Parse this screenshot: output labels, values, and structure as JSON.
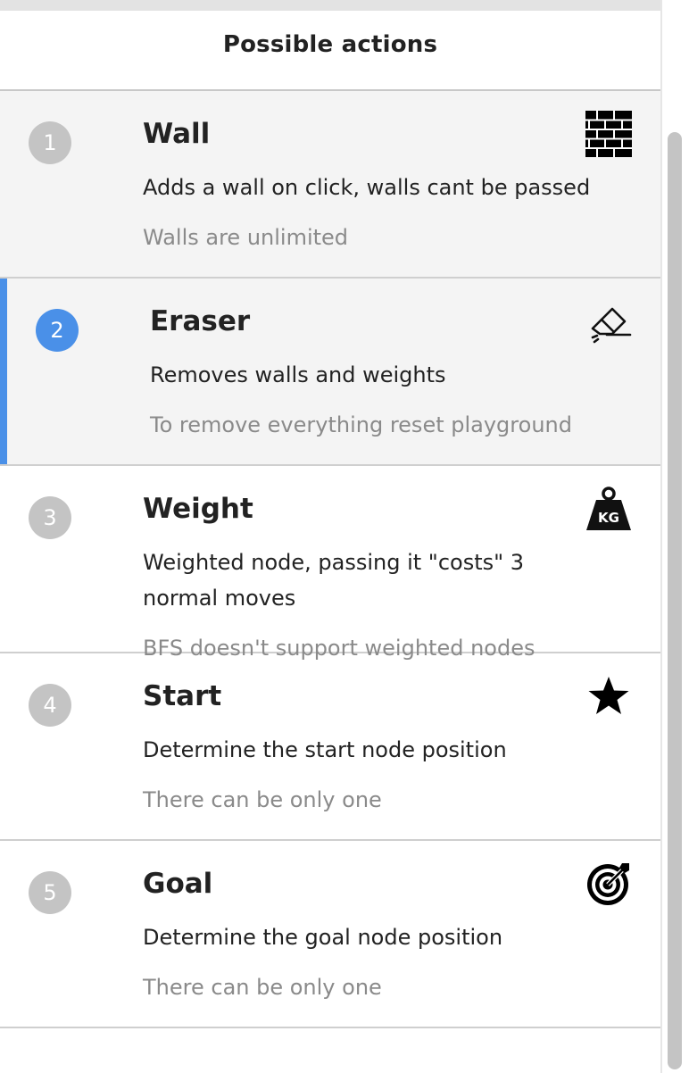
{
  "header": {
    "title": "Possible actions"
  },
  "items": [
    {
      "number": "1",
      "title": "Wall",
      "description": "Adds a wall on click, walls cant be passed",
      "note": "Walls are unlimited",
      "icon": "brick-wall-icon"
    },
    {
      "number": "2",
      "title": "Eraser",
      "description": "Removes walls and weights",
      "note": "To remove everything reset playground",
      "icon": "eraser-icon",
      "selected": true
    },
    {
      "number": "3",
      "title": "Weight",
      "description": "Weighted node, passing it \"costs\" 3 normal moves",
      "note": "BFS doesn't support weighted nodes",
      "icon": "kg-weight-icon",
      "icon_label": "KG"
    },
    {
      "number": "4",
      "title": "Start",
      "description": "Determine the start node position",
      "note": "There can be only one",
      "icon": "star-icon"
    },
    {
      "number": "5",
      "title": "Goal",
      "description": "Determine the goal node position",
      "note": "There can be only one",
      "icon": "target-icon"
    }
  ],
  "colors": {
    "accent": "#4a90e8",
    "badge": "#c4c4c4",
    "note_text": "#8a8a8a",
    "hover_bg": "#f4f4f4"
  }
}
